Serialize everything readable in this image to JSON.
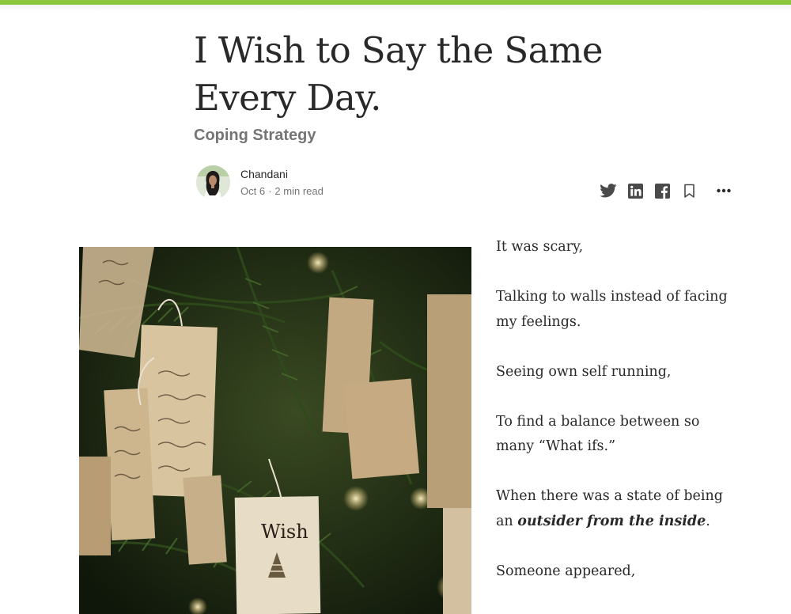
{
  "article": {
    "title": "I Wish to Say the Same Every Day.",
    "subtitle": "Coping Strategy",
    "author": "Chandani",
    "date": "Oct 6",
    "separator": "·",
    "read_time": "2 min read"
  },
  "share_icons": [
    "twitter-icon",
    "linkedin-icon",
    "facebook-icon",
    "bookmark-icon",
    "more-icon"
  ],
  "hero_image": {
    "tag_text": "Wish"
  },
  "body": {
    "p1": "It was scary,",
    "p2": "Talking to walls instead of facing my feelings.",
    "p3": "Seeing own self running,",
    "p4": "To find a balance between so many “What ifs.”",
    "p5_before": "When there was a state of being an ",
    "p5_emphasis": "outsider from the inside",
    "p5_after": ".",
    "p6": "Someone appeared,"
  },
  "colors": {
    "accent_bar": "#8cc63f",
    "text": "#292929",
    "muted": "#757575",
    "icon": "#4a4a4a"
  }
}
